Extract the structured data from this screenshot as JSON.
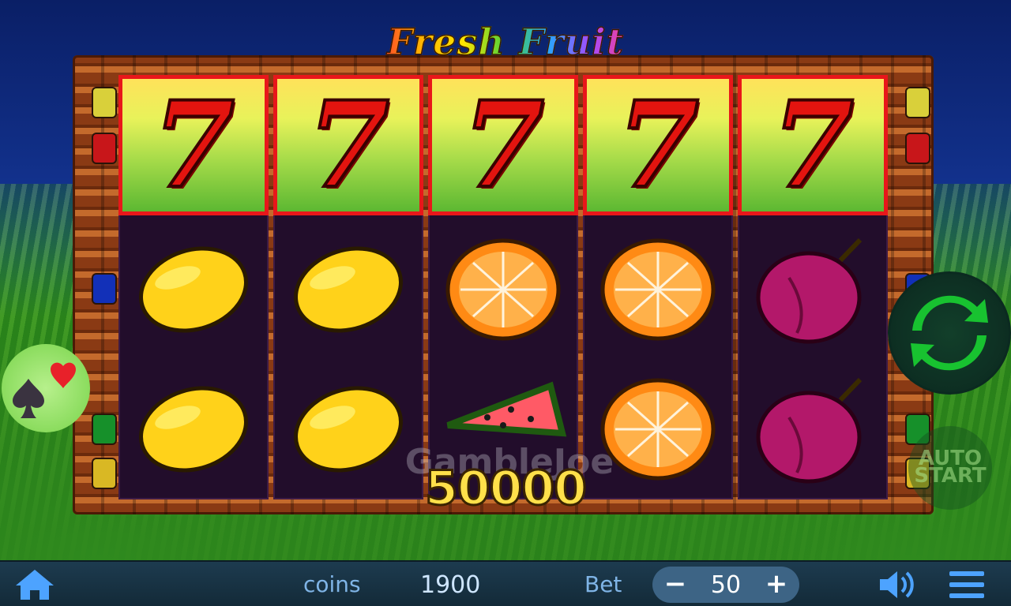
{
  "game": {
    "title": "Fresh Fruit",
    "watermark": "GambleJoe",
    "win_amount": "50000"
  },
  "reels": [
    {
      "symbols": [
        "seven",
        "lemon",
        "lemon"
      ],
      "winning_row": 0
    },
    {
      "symbols": [
        "seven",
        "lemon",
        "lemon"
      ],
      "winning_row": 0
    },
    {
      "symbols": [
        "seven",
        "orange",
        "watermelon"
      ],
      "winning_row": 0
    },
    {
      "symbols": [
        "seven",
        "orange",
        "orange"
      ],
      "winning_row": 0
    },
    {
      "symbols": [
        "seven",
        "plum",
        "plum"
      ],
      "winning_row": 0
    }
  ],
  "seven_glyph": "7",
  "hud": {
    "coins_label": "coins",
    "coins_value": "1900",
    "bet_label": "Bet",
    "bet_value": "50",
    "minus_label": "−",
    "plus_label": "+"
  },
  "side_buttons": {
    "autoplay_label": "AUTO\nSTART"
  },
  "icons": {
    "home": "home-icon",
    "sound": "speaker-icon",
    "menu": "hamburger-menu-icon",
    "spin": "refresh-spin-icon",
    "gamble": "card-suits-icon"
  },
  "colors": {
    "win_border": "#e8171a",
    "spin_green": "#18c230",
    "win_text": "#ffe04a",
    "hud_bg": "#1d3b4f"
  }
}
